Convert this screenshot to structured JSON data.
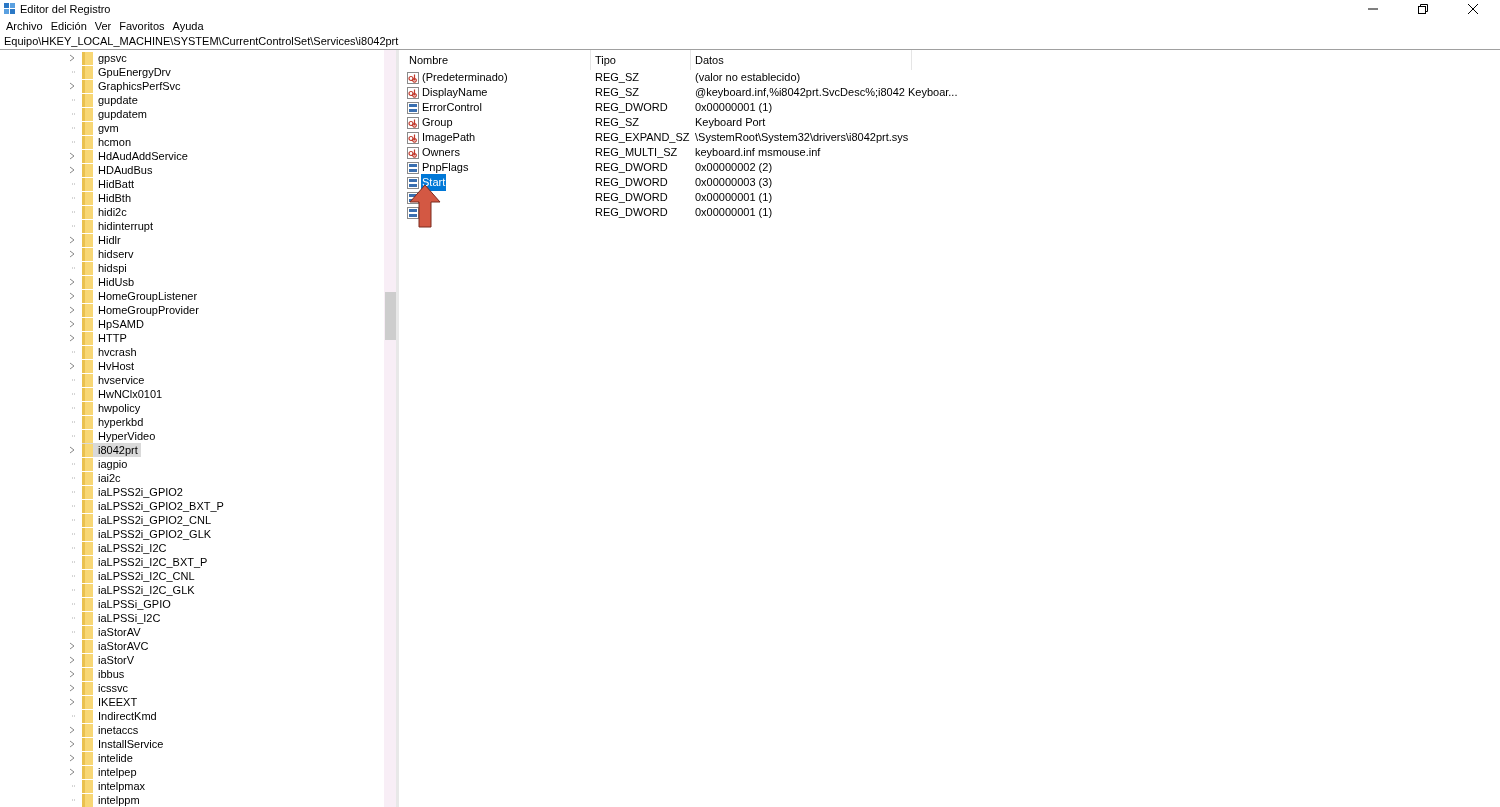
{
  "window": {
    "title": "Editor del Registro"
  },
  "menu": [
    "Archivo",
    "Edición",
    "Ver",
    "Favoritos",
    "Ayuda"
  ],
  "address": "Equipo\\HKEY_LOCAL_MACHINE\\SYSTEM\\CurrentControlSet\\Services\\i8042prt",
  "tree": [
    {
      "label": "gpsvc",
      "expandable": true,
      "selected": false
    },
    {
      "label": "GpuEnergyDrv",
      "expandable": false,
      "selected": false
    },
    {
      "label": "GraphicsPerfSvc",
      "expandable": true,
      "selected": false
    },
    {
      "label": "gupdate",
      "expandable": false,
      "selected": false
    },
    {
      "label": "gupdatem",
      "expandable": false,
      "selected": false
    },
    {
      "label": "gvm",
      "expandable": false,
      "selected": false
    },
    {
      "label": "hcmon",
      "expandable": false,
      "selected": false
    },
    {
      "label": "HdAudAddService",
      "expandable": true,
      "selected": false
    },
    {
      "label": "HDAudBus",
      "expandable": true,
      "selected": false
    },
    {
      "label": "HidBatt",
      "expandable": false,
      "selected": false
    },
    {
      "label": "HidBth",
      "expandable": false,
      "selected": false
    },
    {
      "label": "hidi2c",
      "expandable": false,
      "selected": false
    },
    {
      "label": "hidinterrupt",
      "expandable": false,
      "selected": false
    },
    {
      "label": "Hidlr",
      "expandable": true,
      "selected": false
    },
    {
      "label": "hidserv",
      "expandable": true,
      "selected": false
    },
    {
      "label": "hidspi",
      "expandable": false,
      "selected": false
    },
    {
      "label": "HidUsb",
      "expandable": true,
      "selected": false
    },
    {
      "label": "HomeGroupListener",
      "expandable": true,
      "selected": false
    },
    {
      "label": "HomeGroupProvider",
      "expandable": true,
      "selected": false
    },
    {
      "label": "HpSAMD",
      "expandable": true,
      "selected": false
    },
    {
      "label": "HTTP",
      "expandable": true,
      "selected": false
    },
    {
      "label": "hvcrash",
      "expandable": false,
      "selected": false
    },
    {
      "label": "HvHost",
      "expandable": true,
      "selected": false
    },
    {
      "label": "hvservice",
      "expandable": false,
      "selected": false
    },
    {
      "label": "HwNClx0101",
      "expandable": false,
      "selected": false
    },
    {
      "label": "hwpolicy",
      "expandable": false,
      "selected": false
    },
    {
      "label": "hyperkbd",
      "expandable": false,
      "selected": false
    },
    {
      "label": "HyperVideo",
      "expandable": false,
      "selected": false
    },
    {
      "label": "i8042prt",
      "expandable": true,
      "selected": true
    },
    {
      "label": "iagpio",
      "expandable": false,
      "selected": false
    },
    {
      "label": "iai2c",
      "expandable": false,
      "selected": false
    },
    {
      "label": "iaLPSS2i_GPIO2",
      "expandable": false,
      "selected": false
    },
    {
      "label": "iaLPSS2i_GPIO2_BXT_P",
      "expandable": false,
      "selected": false
    },
    {
      "label": "iaLPSS2i_GPIO2_CNL",
      "expandable": false,
      "selected": false
    },
    {
      "label": "iaLPSS2i_GPIO2_GLK",
      "expandable": false,
      "selected": false
    },
    {
      "label": "iaLPSS2i_I2C",
      "expandable": false,
      "selected": false
    },
    {
      "label": "iaLPSS2i_I2C_BXT_P",
      "expandable": false,
      "selected": false
    },
    {
      "label": "iaLPSS2i_I2C_CNL",
      "expandable": false,
      "selected": false
    },
    {
      "label": "iaLPSS2i_I2C_GLK",
      "expandable": false,
      "selected": false
    },
    {
      "label": "iaLPSSi_GPIO",
      "expandable": false,
      "selected": false
    },
    {
      "label": "iaLPSSi_I2C",
      "expandable": false,
      "selected": false
    },
    {
      "label": "iaStorAV",
      "expandable": false,
      "selected": false
    },
    {
      "label": "iaStorAVC",
      "expandable": true,
      "selected": false
    },
    {
      "label": "iaStorV",
      "expandable": true,
      "selected": false
    },
    {
      "label": "ibbus",
      "expandable": true,
      "selected": false
    },
    {
      "label": "icssvc",
      "expandable": true,
      "selected": false
    },
    {
      "label": "IKEEXT",
      "expandable": true,
      "selected": false
    },
    {
      "label": "IndirectKmd",
      "expandable": false,
      "selected": false
    },
    {
      "label": "inetaccs",
      "expandable": true,
      "selected": false
    },
    {
      "label": "InstallService",
      "expandable": true,
      "selected": false
    },
    {
      "label": "intelide",
      "expandable": true,
      "selected": false
    },
    {
      "label": "intelpep",
      "expandable": true,
      "selected": false
    },
    {
      "label": "intelpmax",
      "expandable": false,
      "selected": false
    },
    {
      "label": "intelppm",
      "expandable": false,
      "selected": false
    }
  ],
  "table": {
    "columns": [
      "Nombre",
      "Tipo",
      "Datos"
    ],
    "rows": [
      {
        "kind": "string",
        "name": "(Predeterminado)",
        "type": "REG_SZ",
        "data": "(valor no establecido)",
        "selected": false
      },
      {
        "kind": "string",
        "name": "DisplayName",
        "type": "REG_SZ",
        "data": "@keyboard.inf,%i8042prt.SvcDesc%;i8042 Keyboar...",
        "selected": false
      },
      {
        "kind": "binary",
        "name": "ErrorControl",
        "type": "REG_DWORD",
        "data": "0x00000001 (1)",
        "selected": false
      },
      {
        "kind": "string",
        "name": "Group",
        "type": "REG_SZ",
        "data": "Keyboard Port",
        "selected": false
      },
      {
        "kind": "string",
        "name": "ImagePath",
        "type": "REG_EXPAND_SZ",
        "data": "\\SystemRoot\\System32\\drivers\\i8042prt.sys",
        "selected": false
      },
      {
        "kind": "string",
        "name": "Owners",
        "type": "REG_MULTI_SZ",
        "data": "keyboard.inf msmouse.inf",
        "selected": false
      },
      {
        "kind": "binary",
        "name": "PnpFlags",
        "type": "REG_DWORD",
        "data": "0x00000002 (2)",
        "selected": false
      },
      {
        "kind": "binary",
        "name": "Start",
        "type": "REG_DWORD",
        "data": "0x00000003 (3)",
        "selected": true
      },
      {
        "kind": "binary",
        "type": "REG_DWORD",
        "data": "0x00000001 (1)",
        "selected": false
      },
      {
        "kind": "binary",
        "type": "REG_DWORD",
        "data": "0x00000001 (1)",
        "selected": false
      }
    ]
  }
}
